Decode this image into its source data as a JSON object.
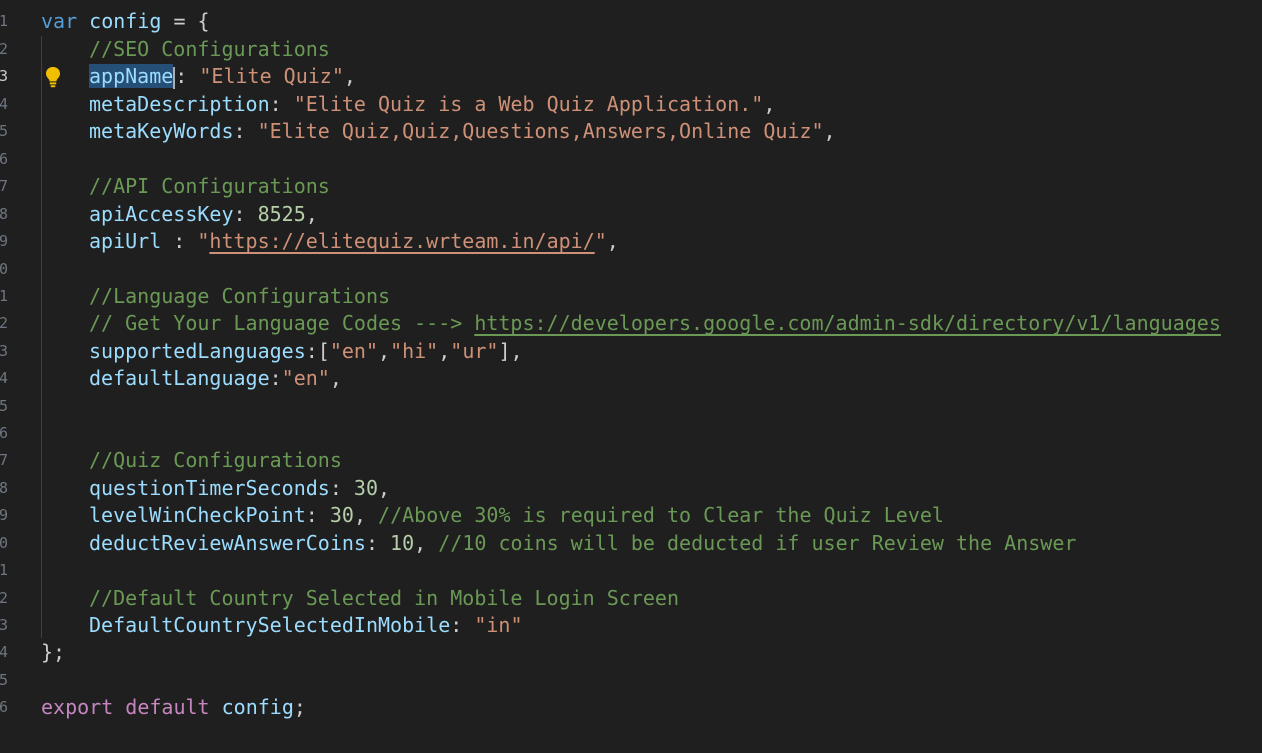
{
  "gutter": {
    "line_numbers": [
      "1",
      "2",
      "3",
      "4",
      "5",
      "6",
      "7",
      "8",
      "9",
      "0",
      "1",
      "2",
      "3",
      "4",
      "5",
      "6",
      "7",
      "8",
      "9",
      "0",
      "1",
      "2",
      "3",
      "4",
      "5",
      "6"
    ]
  },
  "code": {
    "l1": {
      "kw": "var",
      "name": "config",
      "eq": " = {"
    },
    "l2": {
      "comment": "//SEO Configurations"
    },
    "l3": {
      "prop": "appName",
      "colon": ": ",
      "value": "\"Elite Quiz\"",
      "end": ","
    },
    "l4": {
      "prop": "metaDescription",
      "colon": ": ",
      "value": "\"Elite Quiz is a Web Quiz Application.\"",
      "end": ","
    },
    "l5": {
      "prop": "metaKeyWords",
      "colon": ": ",
      "value": "\"Elite Quiz,Quiz,Questions,Answers,Online Quiz\"",
      "end": ","
    },
    "l7": {
      "comment": "//API Configurations"
    },
    "l8": {
      "prop": "apiAccessKey",
      "colon": ": ",
      "value": "8525",
      "end": ","
    },
    "l9": {
      "prop": "apiUrl",
      "colon": " : ",
      "quote_open": "\"",
      "url": "https://elitequiz.wrteam.in/api/",
      "quote_close": "\"",
      "end": ","
    },
    "l11": {
      "comment": "//Language Configurations"
    },
    "l12": {
      "comment": "// Get Your Language Codes ---> ",
      "url": "https://developers.google.com/admin-sdk/directory/v1/languages"
    },
    "l13": {
      "prop": "supportedLanguages",
      "colon": ":[",
      "v1": "\"en\"",
      "c1": ",",
      "v2": "\"hi\"",
      "c2": ",",
      "v3": "\"ur\"",
      "end": "],"
    },
    "l14": {
      "prop": "defaultLanguage",
      "colon": ":",
      "value": "\"en\"",
      "end": ","
    },
    "l17": {
      "comment": "//Quiz Configurations"
    },
    "l18": {
      "prop": "questionTimerSeconds",
      "colon": ": ",
      "value": "30",
      "end": ","
    },
    "l19": {
      "prop": "levelWinCheckPoint",
      "colon": ": ",
      "value": "30",
      "end": ", ",
      "comment": "//Above 30% is required to Clear the Quiz Level"
    },
    "l20": {
      "prop": "deductReviewAnswerCoins",
      "colon": ": ",
      "value": "10",
      "end": ", ",
      "comment": "//10 coins will be deducted if user Review the Answer"
    },
    "l22": {
      "comment": "//Default Country Selected in Mobile Login Screen"
    },
    "l23": {
      "prop": "DefaultCountrySelectedInMobile",
      "colon": ": ",
      "value": "\"in\""
    },
    "l24": {
      "close": "};"
    },
    "l26": {
      "kw1": "export",
      "kw2": "default",
      "name": "config",
      "end": ";"
    }
  },
  "icons": {
    "lightbulb": "lightbulb-icon"
  },
  "colors": {
    "background": "#1f1f1f",
    "keyword": "#569cd6",
    "control_keyword": "#c586c0",
    "variable": "#9cdcfe",
    "string": "#ce9178",
    "number": "#b5cea8",
    "comment": "#6a9955",
    "selection": "#264f78",
    "lightbulb": "#f0c000"
  }
}
